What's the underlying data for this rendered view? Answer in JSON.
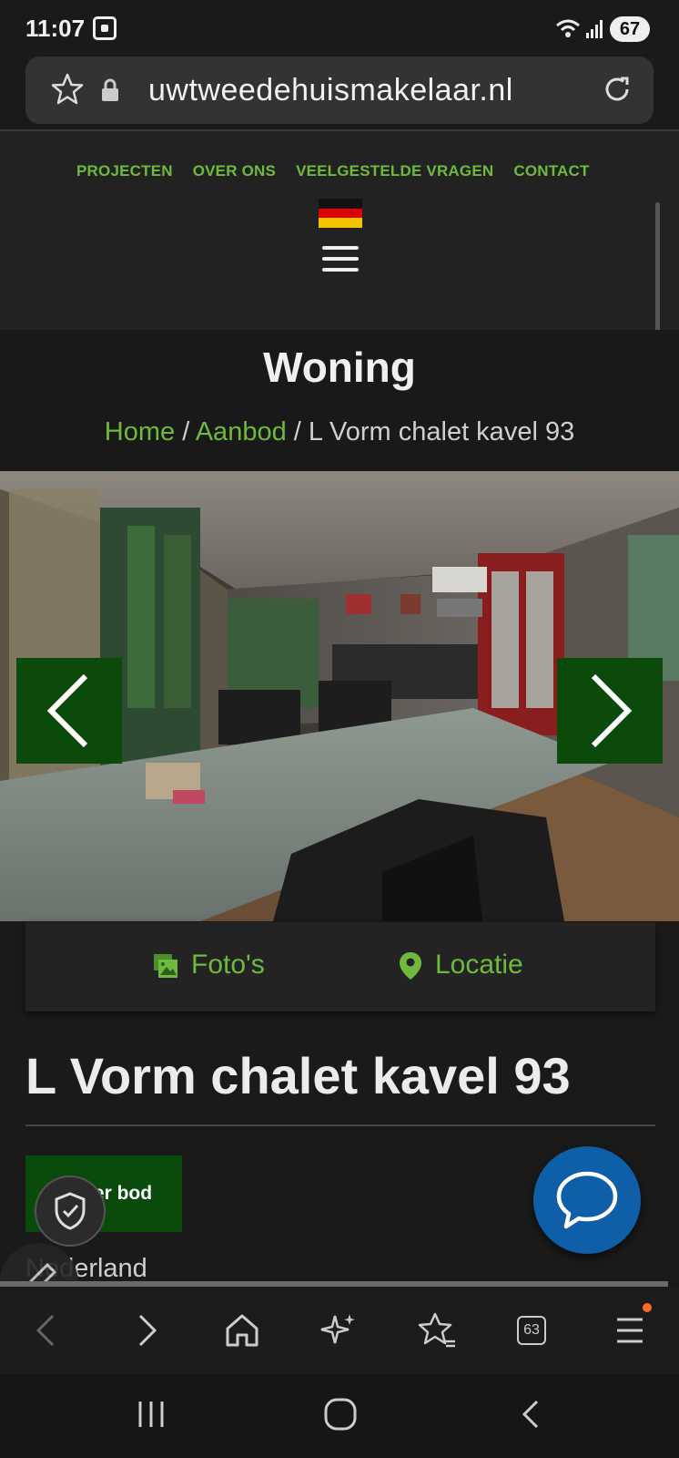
{
  "status": {
    "time": "11:07",
    "battery": "67"
  },
  "browser": {
    "url": "uwtweedehuismakelaar.nl",
    "tabs_count": "63"
  },
  "nav": {
    "links": [
      "PROJECTEN",
      "OVER ONS",
      "VEELGESTELDE VRAGEN",
      "CONTACT"
    ]
  },
  "hero": {
    "title": "Woning",
    "crumb_home": "Home",
    "crumb_sep": " / ",
    "crumb_listing": "Aanbod",
    "crumb_current": "L Vorm chalet kavel 93"
  },
  "tabs": {
    "photos": "Foto's",
    "location": "Locatie"
  },
  "listing": {
    "title": "L Vorm chalet kavel 93",
    "status_badge": "Onder bod",
    "country": "Nederland"
  },
  "colors": {
    "accent_green": "#6fba3c",
    "dark_green": "#0b4a0b",
    "chat_blue": "#0f5fa8"
  }
}
